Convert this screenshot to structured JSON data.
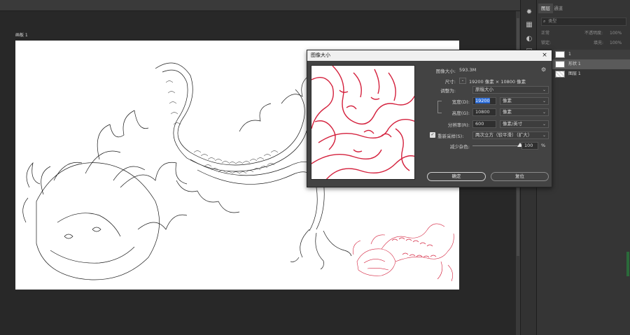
{
  "document": {
    "tab_title": "画板 1"
  },
  "panel": {
    "tabs": [
      "图层",
      "通道"
    ],
    "search_placeholder": "类型",
    "blend_mode": "正常",
    "opacity_label": "不透明度:",
    "opacity_value": "100%",
    "lock_label": "锁定:",
    "fill_label": "填充:",
    "fill_value": "100%",
    "layers": [
      {
        "name": "1",
        "type": "artboard",
        "selected": false
      },
      {
        "name": "形状 1",
        "type": "shape",
        "selected": true
      },
      {
        "name": "图层 1",
        "type": "pixel",
        "selected": false
      }
    ]
  },
  "dialog": {
    "title": "图像大小",
    "close_symbol": "×",
    "image_size_label": "图像大小:",
    "image_size_value": "593.3M",
    "dimensions_label": "尺寸:",
    "dimensions_value": "19200 像素 × 10800 像素",
    "fit_to_label": "调整为:",
    "fit_to_value": "原稿大小",
    "width_label": "宽度(D):",
    "width_value": "19200",
    "width_unit": "像素",
    "height_label": "高度(G):",
    "height_value": "10800",
    "height_unit": "像素",
    "resolution_label": "分辨率(R):",
    "resolution_value": "600",
    "resolution_unit": "像素/英寸",
    "resample_label": "重新采样(S):",
    "resample_checked": true,
    "resample_value": "两次立方（较平滑）（扩大）",
    "reduce_noise_label": "减少杂色:",
    "reduce_noise_value": "100",
    "reduce_noise_unit": "%",
    "reduce_noise_level": 1.0,
    "ok_label": "确定",
    "reset_label": "复位"
  },
  "colors": {
    "line_art": "#1a1a1a",
    "red_art": "#d4213d",
    "selection": "#2b6bd6"
  }
}
